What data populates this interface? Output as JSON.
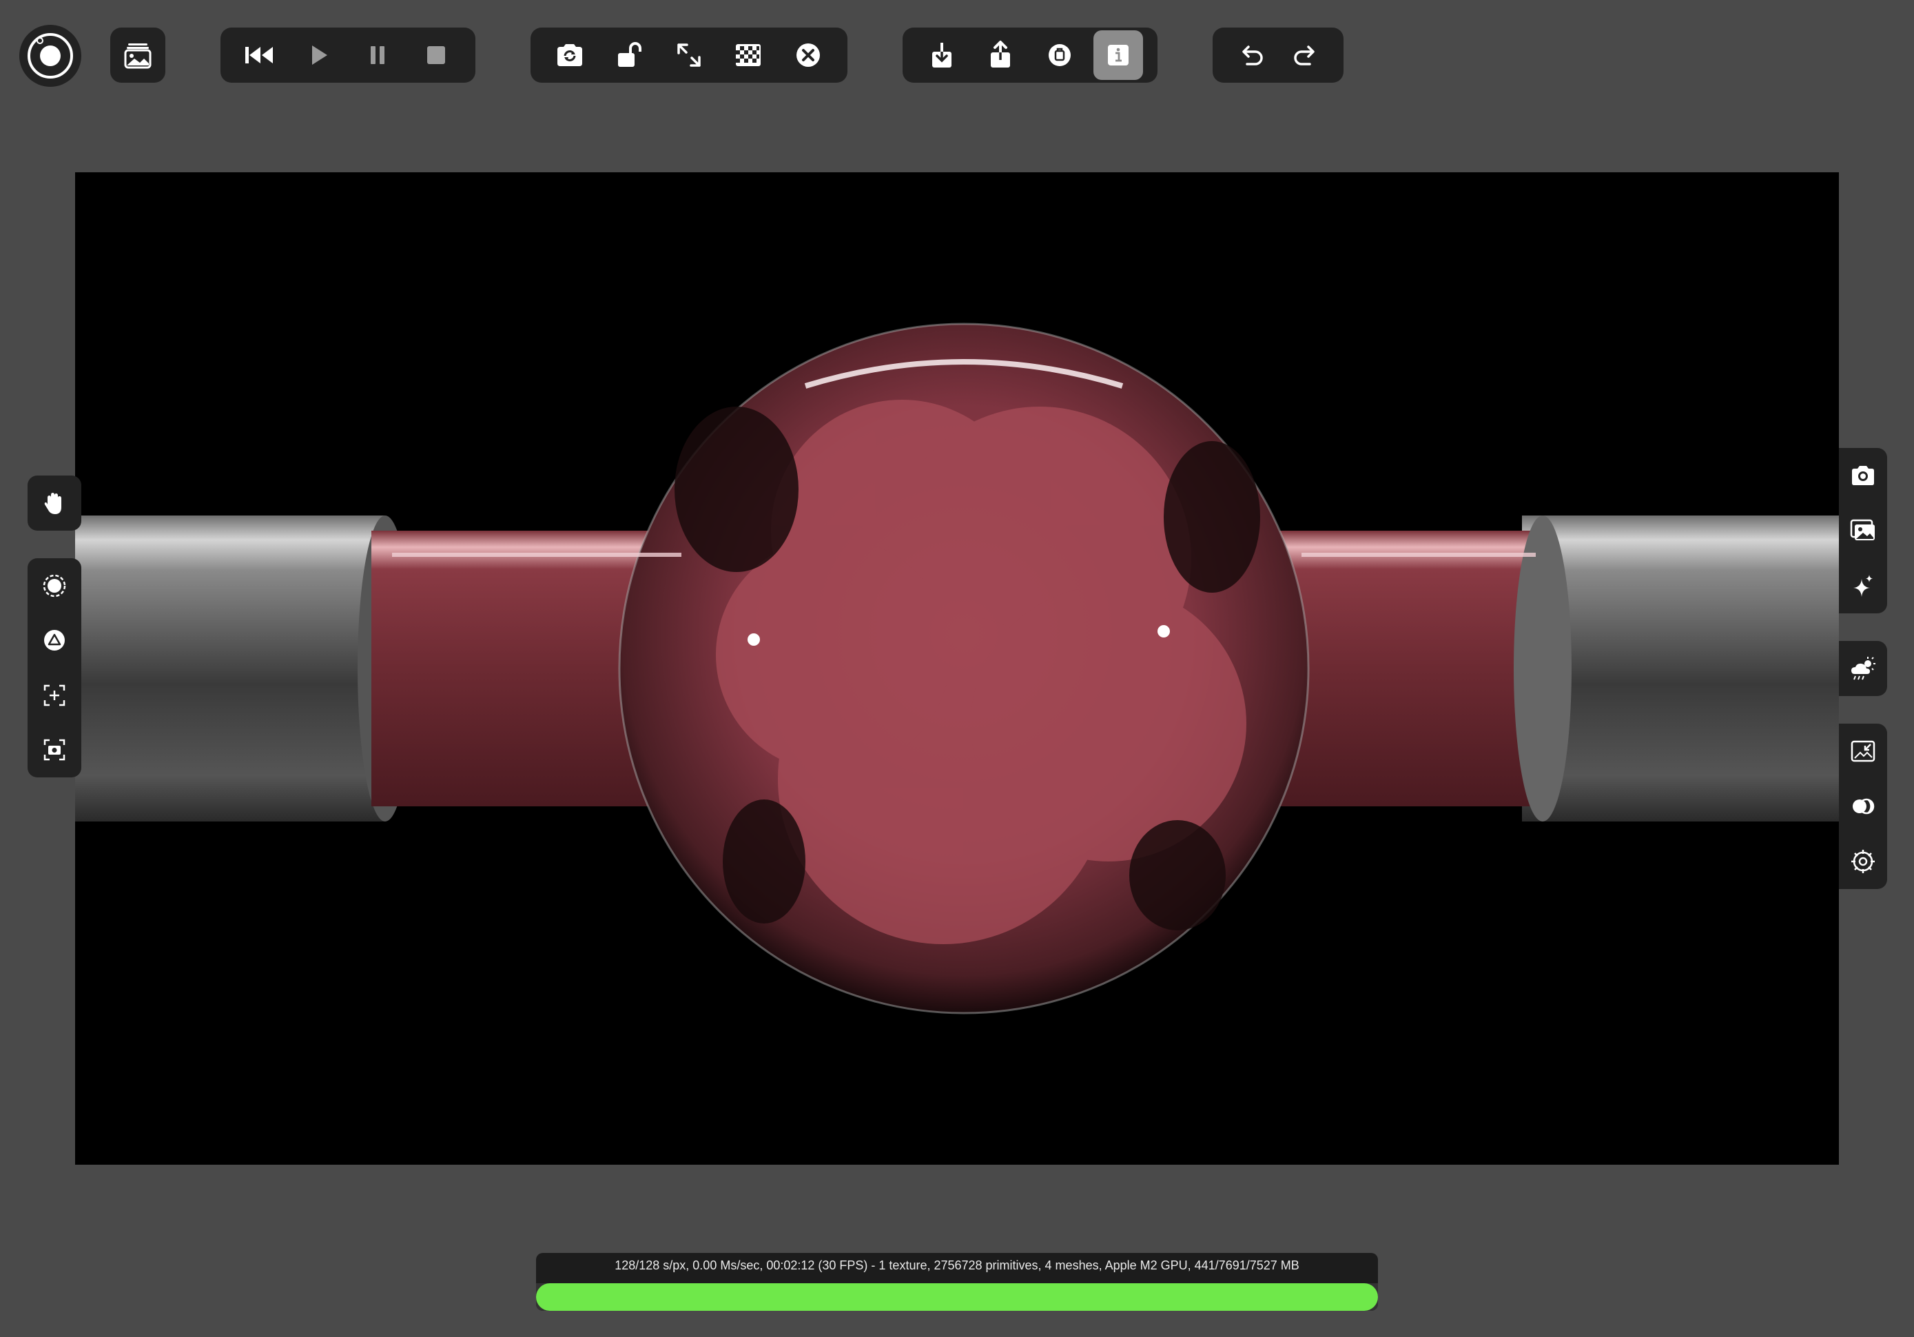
{
  "toolbar": {
    "app_logo_icon": "aperture-logo-icon",
    "gallery_icon": "image-stack-icon",
    "playback": [
      "skip-to-start-icon",
      "play-icon",
      "pause-icon",
      "stop-icon"
    ],
    "render": [
      "camera-refresh-icon",
      "unlock-icon",
      "expand-icon",
      "checkerboard-icon",
      "close-circle-icon"
    ],
    "files": [
      "download-icon",
      "share-icon",
      "badge-icon",
      "info-icon"
    ],
    "history": [
      "undo-icon",
      "redo-icon"
    ]
  },
  "left_tools": {
    "hand": "hand-icon",
    "items": [
      "sphere-select-icon",
      "triangle-icon",
      "focus-plus-icon",
      "focus-camera-icon"
    ]
  },
  "right_tools": {
    "group1": [
      "camera-icon",
      "image-icon",
      "sparkle-icon"
    ],
    "group2": [
      "weather-icon"
    ],
    "group3": [
      "fit-view-icon",
      "toggle-icon",
      "settings-icon"
    ]
  },
  "status": {
    "text": "128/128 s/px, 0.00 Ms/sec, 00:02:12 (30 FPS) - 1 texture, 2756728 primitives, 4 meshes, Apple M2 GPU, 441/7691/7527 MB",
    "progress": 1.0
  },
  "colors": {
    "background": "#4a4a4a",
    "panel": "#222222",
    "progress": "#6fe84a",
    "fluid": "#9a4450"
  }
}
